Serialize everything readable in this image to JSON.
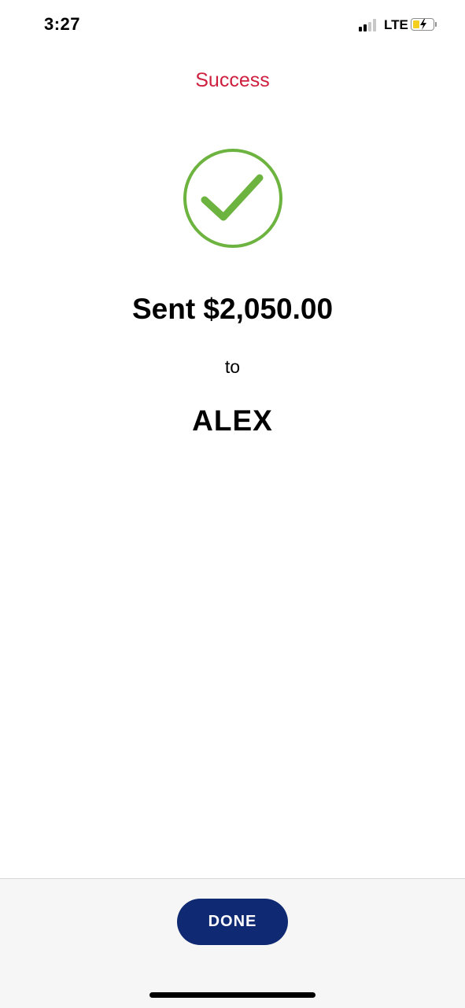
{
  "status_bar": {
    "time": "3:27",
    "network": "LTE",
    "signal_bars_active": 2,
    "signal_bars_total": 4,
    "battery_level": 0.3,
    "battery_charging": true,
    "battery_color": "#f4cf1f"
  },
  "screen": {
    "title": "Success",
    "title_color": "#cf1f3f",
    "icon": "checkmark-circle-icon",
    "icon_color": "#6db33f",
    "amount_text": "Sent $2,050.00",
    "connector_text": "to",
    "recipient_name": "ALEX"
  },
  "footer": {
    "done_label": "DONE",
    "button_color": "#0f2a72"
  }
}
